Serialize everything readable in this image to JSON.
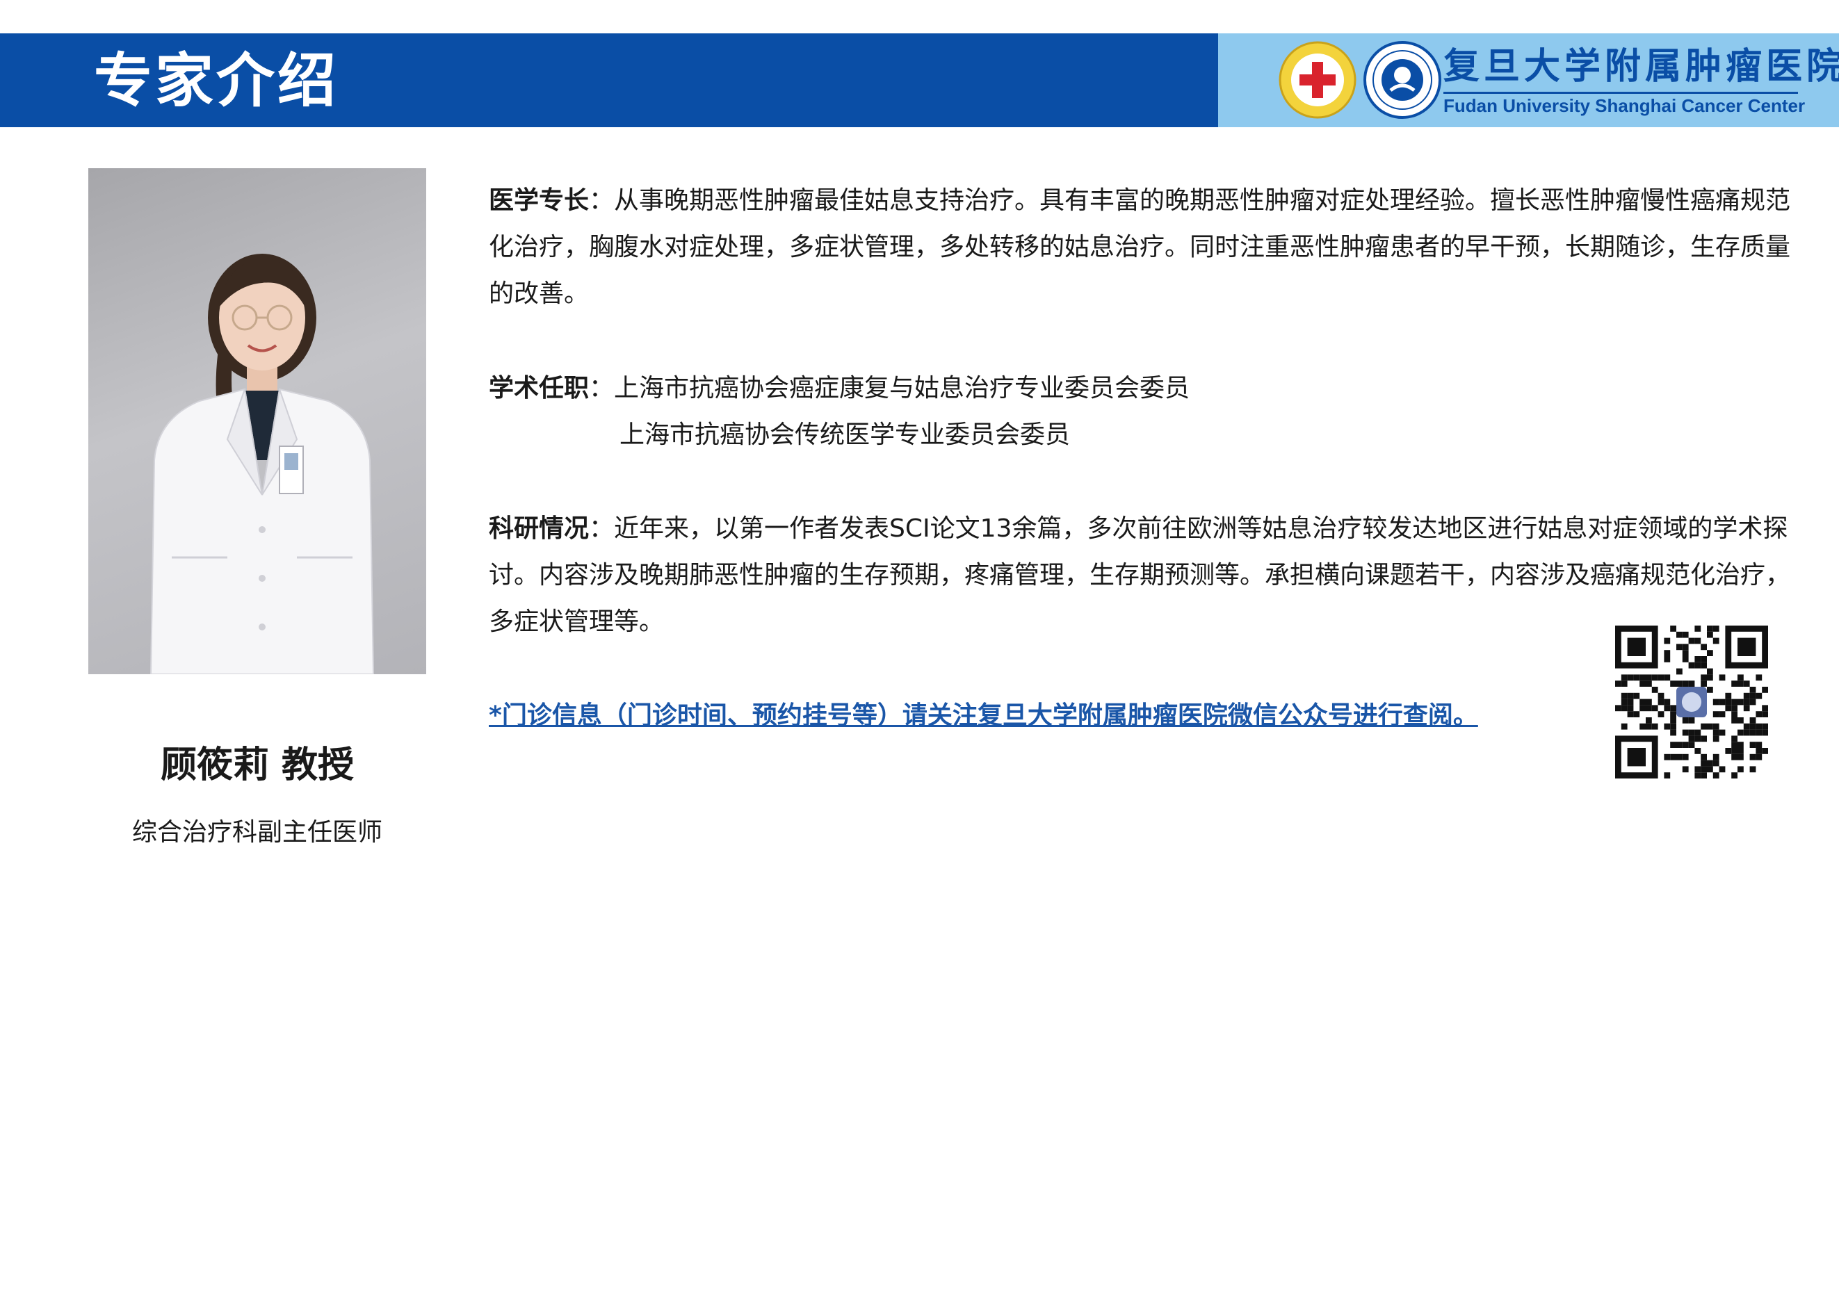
{
  "header": {
    "title": "专家介绍",
    "hospital_name_cn": "复旦大学附属肿瘤医院",
    "hospital_name_en": "Fudan University Shanghai Cancer Center",
    "colors": {
      "banner_blue": "#0a4ea6",
      "banner_light": "#8ec9ee"
    }
  },
  "expert": {
    "name": "顾筱莉 教授",
    "position": "综合治疗科副主任医师"
  },
  "sections": {
    "specialty": {
      "label": "医学专长",
      "text": "：从事晚期恶性肿瘤最佳姑息支持治疗。具有丰富的晚期恶性肿瘤对症处理经验。擅长恶性肿瘤慢性癌痛规范化治疗，胸腹水对症处理，多症状管理，多处转移的姑息治疗。同时注重恶性肿瘤患者的早干预，长期随诊，生存质量的改善。"
    },
    "academic": {
      "label": "学术任职",
      "items": [
        "：上海市抗癌协会癌症康复与姑息治疗专业委员会委员",
        "上海市抗癌协会传统医学专业委员会委员"
      ]
    },
    "research": {
      "label": "科研情况",
      "text": "：近年来，以第一作者发表SCI论文13余篇，多次前往欧洲等姑息治疗较发达地区进行姑息对症领域的学术探讨。内容涉及晚期肺恶性肿瘤的生存预期，疼痛管理，生存期预测等。承担横向课题若干，内容涉及癌痛规范化治疗，多症状管理等。"
    }
  },
  "notice": "*门诊信息（门诊时间、预约挂号等）请关注复旦大学附属肿瘤医院微信公众号进行查阅。"
}
